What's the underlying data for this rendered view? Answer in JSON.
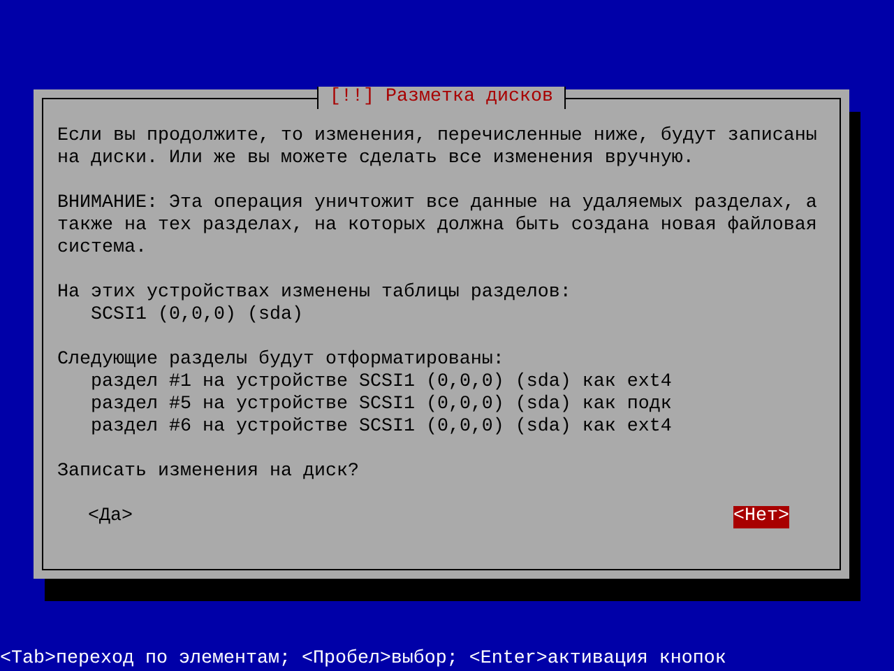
{
  "dialog": {
    "title": "[!!] Разметка дисков",
    "blocks": [
      {
        "kind": "paragraph",
        "text": "Если вы продолжите, то изменения, перечисленные ниже, будут записаны на диски. Или же вы можете сделать все изменения вручную."
      },
      {
        "kind": "paragraph",
        "text": "ВНИМАНИЕ: Эта операция уничтожит все данные на удаляемых разделах, а также на тех разделах, на которых должна быть создана новая файловая система."
      },
      {
        "kind": "list",
        "heading": "На этих устройствах изменены таблицы разделов:",
        "items": [
          "SCSI1 (0,0,0) (sda)"
        ]
      },
      {
        "kind": "list",
        "heading": "Следующие разделы будут отформатированы:",
        "items": [
          "раздел #1 на устройстве SCSI1 (0,0,0) (sda) как ext4",
          "раздел #5 на устройстве SCSI1 (0,0,0) (sda) как подк",
          "раздел #6 на устройстве SCSI1 (0,0,0) (sda) как ext4"
        ]
      },
      {
        "kind": "paragraph",
        "text": "Записать изменения на диск?"
      }
    ],
    "buttons": [
      {
        "label": "<Да>",
        "selected": false
      },
      {
        "label": "<Нет>",
        "selected": true
      }
    ]
  },
  "status_bar": "<Tab>переход по элементам; <Пробел>выбор; <Enter>активация кнопок"
}
